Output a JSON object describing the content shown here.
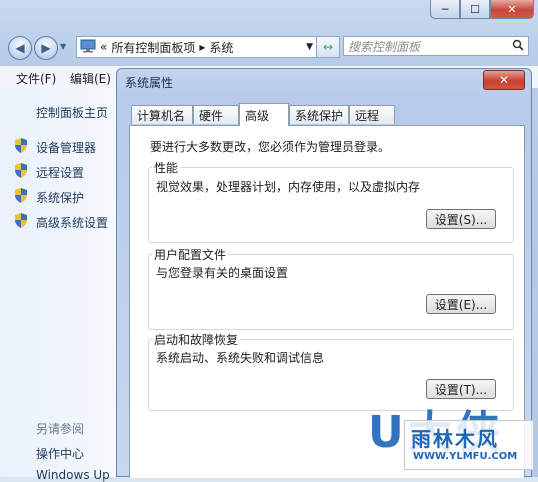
{
  "window": {
    "controls": [
      "─",
      "☐",
      "✕"
    ],
    "nav": {
      "back_icon": "left-arrow",
      "forward_icon": "right-arrow"
    },
    "address": {
      "prefix": "«",
      "crumb1": "所有控制面板项",
      "sep": "▸",
      "crumb2": "系统",
      "dropdown": "▼"
    },
    "search": {
      "placeholder": "搜索控制面板",
      "icon": "🔍"
    },
    "menu": [
      "文件(F)",
      "编辑(E)"
    ]
  },
  "sidebar": {
    "home": "控制面板主页",
    "items": [
      "设备管理器",
      "远程设置",
      "系统保护",
      "高级系统设置"
    ],
    "see_also": "另请参阅",
    "links": [
      "操作中心",
      "Windows Up"
    ]
  },
  "dialog": {
    "title": "系统属性",
    "close": "✕",
    "tabs": [
      "计算机名",
      "硬件",
      "高级",
      "系统保护",
      "远程"
    ],
    "active_tab": "高级",
    "admin_note": "要进行大多数更改，您必须作为管理员登录。",
    "performance": {
      "label": "性能",
      "desc": "视觉效果，处理器计划，内存使用，以及虚拟内存",
      "button": "设置(S)..."
    },
    "user_profiles": {
      "label": "用户配置文件",
      "desc": "与您登录有关的桌面设置",
      "button": "设置(E)..."
    },
    "startup": {
      "label": "启动和故障恢复",
      "desc": "系统启动、系统失败和调试信息",
      "button": "设置(T)..."
    }
  },
  "watermark": {
    "big": "U大侠",
    "name": "雨林木风",
    "url": "WWW.YLMFU.COM"
  },
  "colors": {
    "accent": "#1d66b8",
    "close_red": "#c6402f",
    "window_blue": "#b7cce8"
  }
}
